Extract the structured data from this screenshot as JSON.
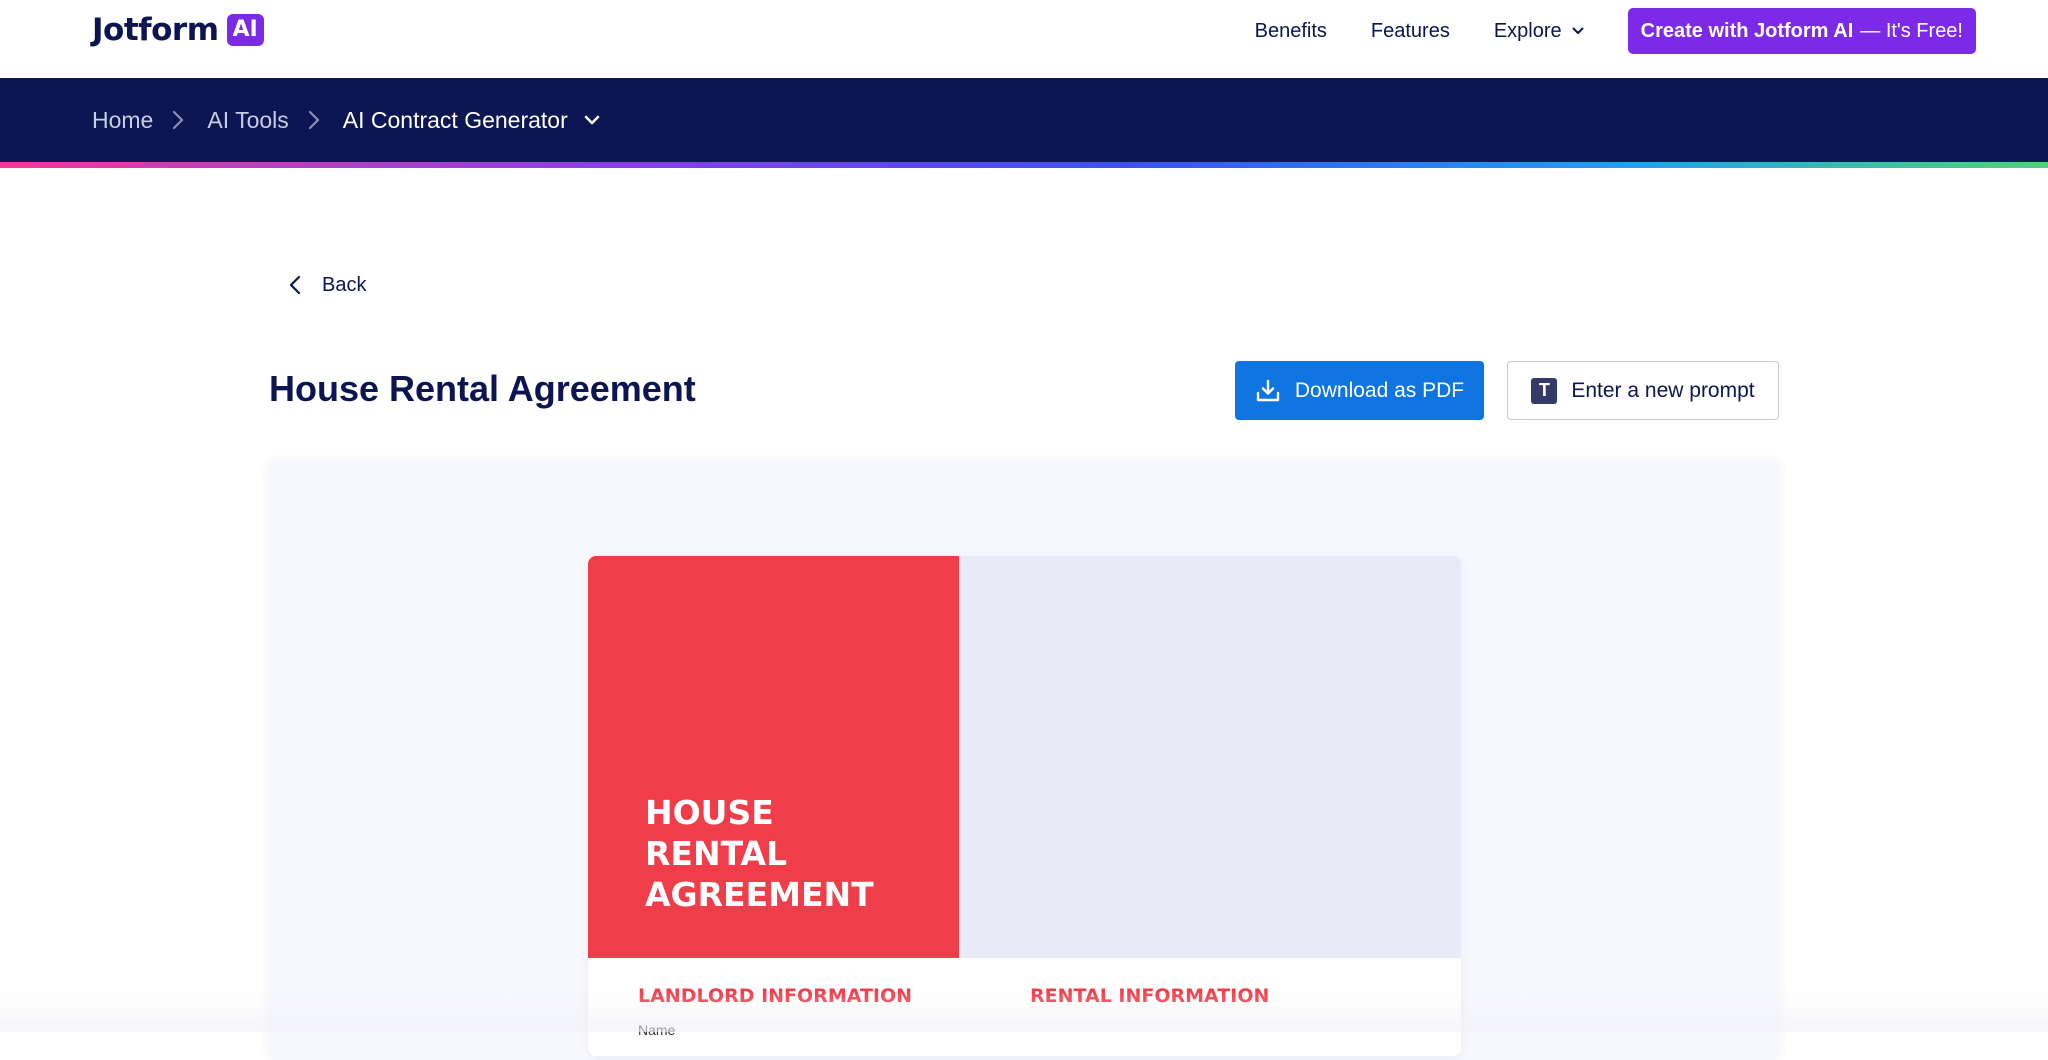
{
  "nav": {
    "logo_text": "Jotform",
    "logo_badge": "AI",
    "links": [
      {
        "label": "Benefits"
      },
      {
        "label": "Features"
      },
      {
        "label": "Explore"
      }
    ],
    "cta_bold": "Create with Jotform AI",
    "cta_light": "— It's Free!"
  },
  "breadcrumb": {
    "items": [
      {
        "label": "Home"
      },
      {
        "label": "AI Tools"
      },
      {
        "label": "AI Contract Generator"
      }
    ]
  },
  "back_label": "Back",
  "page_title": "House Rental Agreement",
  "actions": {
    "download_label": "Download as PDF",
    "prompt_icon": "T",
    "prompt_label": "Enter a new prompt"
  },
  "document": {
    "cover_lines": [
      "HOUSE",
      "RENTAL",
      "AGREEMENT"
    ],
    "section_landlord": "LANDLORD INFORMATION",
    "section_rental": "RENTAL INFORMATION",
    "first_field_label": "Name"
  },
  "colors": {
    "brand_purple": "#7c2ae8",
    "navy": "#0c1652",
    "download_blue": "#0e75e0",
    "doc_red": "#ef3e4a"
  }
}
